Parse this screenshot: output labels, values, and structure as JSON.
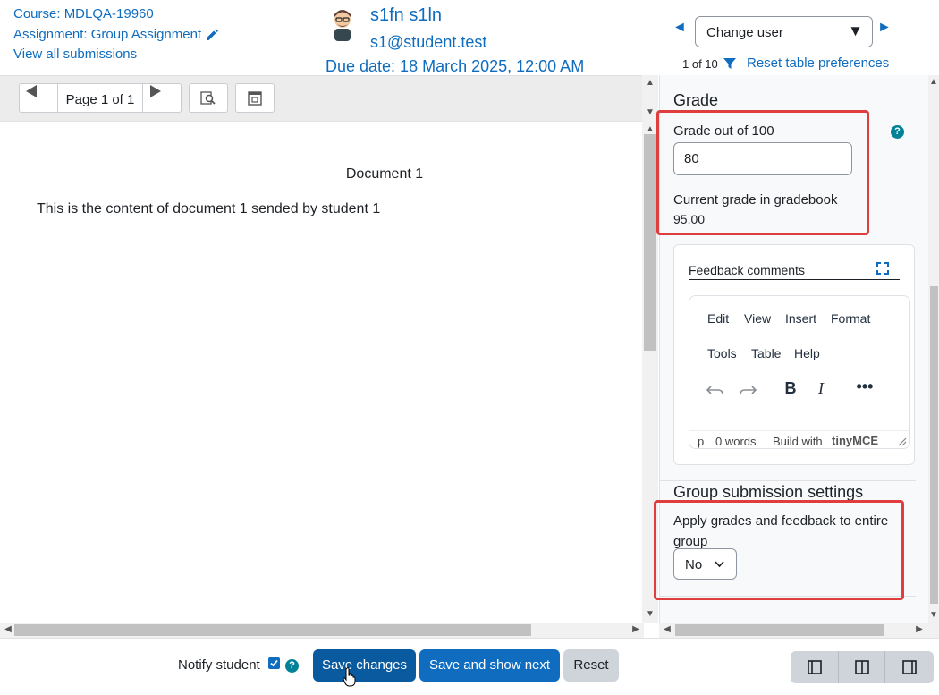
{
  "header": {
    "course": "Course: MDLQA-19960",
    "assignment": "Assignment: Group Assignment",
    "view_all": "View all submissions",
    "user_name": "s1fn s1ln",
    "user_email": "s1@student.test",
    "due_date": "Due date: 18 March 2025, 12:00 AM",
    "change_user": {
      "selected": "Change user"
    },
    "counter": "1 of 10",
    "reset_prefs": "Reset table preferences"
  },
  "viewer": {
    "page_label": "Page 1 of 1",
    "doc_title": "Document 1",
    "doc_body": "This is the content of document 1 sended by student 1"
  },
  "panel": {
    "grade_heading": "Grade",
    "grade_out_of": "Grade out of 100",
    "grade_value": "80",
    "current_grade_label": "Current grade in gradebook",
    "current_grade_value": "95.00",
    "feedback_title": "Feedback comments",
    "editor_menu": [
      "Edit",
      "View",
      "Insert",
      "Format",
      "Tools",
      "Table",
      "Help"
    ],
    "editor_status": {
      "path": "p",
      "words": "0 words",
      "build_with": "Build with",
      "brand": "tinyMCE"
    },
    "group_heading": "Group submission settings",
    "apply_label": "Apply grades and feedback to entire group",
    "apply_value": "No"
  },
  "footer": {
    "notify_label": "Notify student",
    "notify_checked": true,
    "save": "Save changes",
    "save_next": "Save and show next",
    "reset": "Reset"
  },
  "colors": {
    "accent": "#0f6cbf",
    "highlight": "#e03e3e",
    "help": "#008196"
  }
}
